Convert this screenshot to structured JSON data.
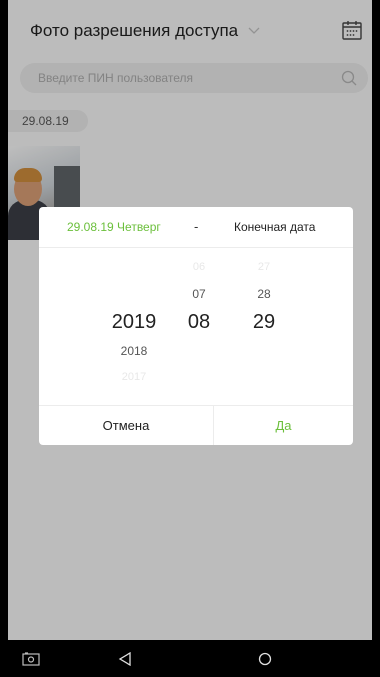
{
  "header": {
    "title": "Фото разрешения доступа",
    "filter_icon": "chevron-down-icon",
    "calendar_icon": "calendar-icon"
  },
  "search": {
    "placeholder": "Введите ПИН пользователя",
    "icon": "search-icon"
  },
  "list": {
    "date_chip": "29.08.19"
  },
  "dialog": {
    "start_label": "29.08.19 Четверг",
    "separator": "-",
    "end_label": "Конечная дата",
    "picker": {
      "year": {
        "above": [
          "",
          ""
        ],
        "selected": "2019",
        "below": [
          "2018",
          "2017"
        ]
      },
      "month": {
        "above": [
          "06",
          "07"
        ],
        "selected": "08",
        "below": []
      },
      "day": {
        "above": [
          "27",
          "28"
        ],
        "selected": "29",
        "below": []
      }
    },
    "cancel_label": "Отмена",
    "ok_label": "Да"
  },
  "colors": {
    "accent": "#6bbf3b",
    "background": "#f1f1f1",
    "dialog": "#ffffff"
  },
  "navbar": {
    "icons": [
      "screenshot-icon",
      "back-icon",
      "home-icon"
    ]
  }
}
